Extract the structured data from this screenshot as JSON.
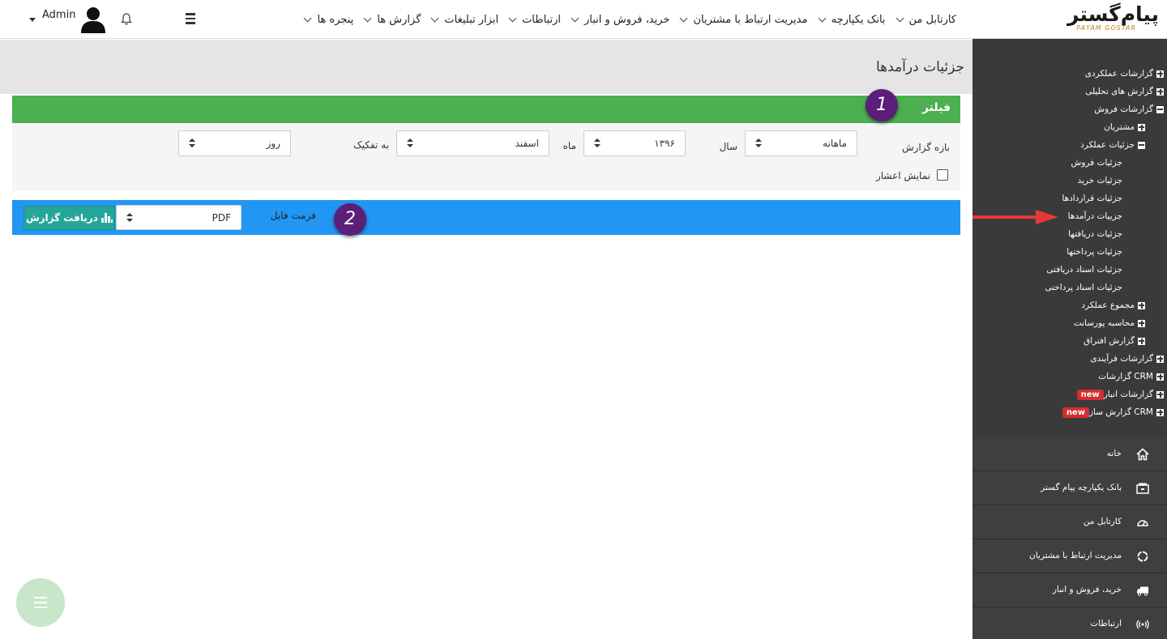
{
  "topbar": {
    "logo_fa": "پیام‌گستر",
    "logo_en": "PAYAM GOSTAR",
    "menu": [
      {
        "label": "کارتابل من"
      },
      {
        "label": "بانک یکپارچه"
      },
      {
        "label": "مدیریت ارتباط با مشتریان"
      },
      {
        "label": "خرید، فروش و انبار"
      },
      {
        "label": "ارتباطات"
      },
      {
        "label": "ابزار تبلیغات"
      },
      {
        "label": "گزارش ها"
      },
      {
        "label": "پنجره ها"
      }
    ],
    "user_name": "Admin"
  },
  "page": {
    "title": "جزئیات درآمدها"
  },
  "filter": {
    "header": "فیلتر",
    "badge": "1",
    "period_label": "بازه گزارش",
    "period_value": "ماهانه",
    "year_label": "سال",
    "year_value": "۱۳۹۶",
    "month_label": "ماه",
    "month_value": "اسفند",
    "breakdown_label": "به تفکیک",
    "breakdown_value": "روز",
    "decimal_label": "نمایش اعشار"
  },
  "export": {
    "badge": "2",
    "format_label": "فرمت فایل",
    "format_value": "PDF",
    "button_label": "دریافت گزارش"
  },
  "sidebar": {
    "tree": [
      {
        "label": "گزارشات عملکردی",
        "state": "plus"
      },
      {
        "label": "گزارش های تحلیلی",
        "state": "plus"
      },
      {
        "label": "گزارشات فروش",
        "state": "minus"
      },
      {
        "label": "مشتریان",
        "state": "plus"
      },
      {
        "label": "جزئیات عملکرد",
        "state": "minus"
      },
      {
        "label": "جزئیات فروش",
        "state": "none"
      },
      {
        "label": "جزئیات خرید",
        "state": "none"
      },
      {
        "label": "جزئیات قراردادها",
        "state": "none"
      },
      {
        "label": "جزییات درآمدها",
        "state": "none"
      },
      {
        "label": "جزئیات دریافتها",
        "state": "none"
      },
      {
        "label": "جزئیات پرداختها",
        "state": "none"
      },
      {
        "label": "جزئیات اسناد دریافتی",
        "state": "none"
      },
      {
        "label": "جزئیات اسناد پرداختی",
        "state": "none"
      },
      {
        "label": "مجموع عملکرد",
        "state": "plus"
      },
      {
        "label": "محاسبه پورسانت",
        "state": "plus"
      },
      {
        "label": "گزارش افتراق",
        "state": "plus"
      },
      {
        "label": "گزارشات فرآیندی",
        "state": "plus"
      },
      {
        "label": "گزارشات CRM",
        "state": "plus"
      },
      {
        "label": "گزارشات انبار",
        "state": "plus",
        "badge": "new"
      },
      {
        "label": "گزارش ساز CRM",
        "state": "plus",
        "badge": "new"
      }
    ],
    "menu": [
      {
        "label": "خانه",
        "icon": "home-icon"
      },
      {
        "label": "بانک یکپارچه پیام گستر",
        "icon": "archive-icon"
      },
      {
        "label": "کارتابل من",
        "icon": "dashboard-icon"
      },
      {
        "label": "مدیریت ارتباط با مشتریان",
        "icon": "cycle-icon"
      },
      {
        "label": "خرید، فروش و انبار",
        "icon": "truck-icon"
      },
      {
        "label": "ارتباطات",
        "icon": "broadcast-icon"
      }
    ]
  },
  "colors": {
    "filter_header": "#4caf50",
    "export_bar": "#2196f3",
    "export_button": "#26a69a",
    "badge": "#5b1f7a",
    "sidebar": "#3a3a3a",
    "new_badge": "#d32f2f",
    "arrow": "#e53935"
  }
}
